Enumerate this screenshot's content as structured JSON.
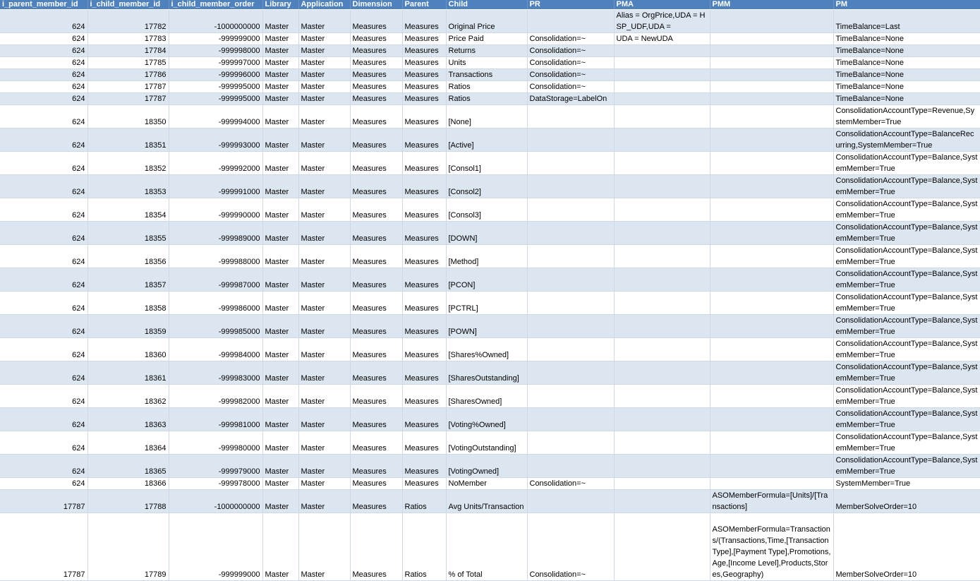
{
  "columns": [
    "i_parent_member_id",
    "i_child_member_id",
    "i_child_member_order",
    "Library",
    "Application",
    "Dimension",
    "Parent",
    "Child",
    "PR",
    "PMA",
    "PMM",
    "PM"
  ],
  "rows": [
    [
      "624",
      "17782",
      "-1000000000",
      "Master",
      "Master",
      "Measures",
      "Measures",
      "Original Price",
      "",
      "Alias = OrgPrice,UDA = HSP_UDF,UDA =",
      "",
      "TimeBalance=Last"
    ],
    [
      "624",
      "17783",
      "-999999000",
      "Master",
      "Master",
      "Measures",
      "Measures",
      "Price Paid",
      "Consolidation=~",
      "UDA = NewUDA",
      "",
      "TimeBalance=None"
    ],
    [
      "624",
      "17784",
      "-999998000",
      "Master",
      "Master",
      "Measures",
      "Measures",
      "Returns",
      "Consolidation=~",
      "",
      "",
      "TimeBalance=None"
    ],
    [
      "624",
      "17785",
      "-999997000",
      "Master",
      "Master",
      "Measures",
      "Measures",
      "Units",
      "Consolidation=~",
      "",
      "",
      "TimeBalance=None"
    ],
    [
      "624",
      "17786",
      "-999996000",
      "Master",
      "Master",
      "Measures",
      "Measures",
      "Transactions",
      "Consolidation=~",
      "",
      "",
      "TimeBalance=None"
    ],
    [
      "624",
      "17787",
      "-999995000",
      "Master",
      "Master",
      "Measures",
      "Measures",
      "Ratios",
      "Consolidation=~",
      "",
      "",
      "TimeBalance=None"
    ],
    [
      "624",
      "17787",
      "-999995000",
      "Master",
      "Master",
      "Measures",
      "Measures",
      "Ratios",
      "DataStorage=LabelOn",
      "",
      "",
      "TimeBalance=None"
    ],
    [
      "624",
      "18350",
      "-999994000",
      "Master",
      "Master",
      "Measures",
      "Measures",
      "[None]",
      "",
      "",
      "",
      "ConsolidationAccountType=Revenue,SystemMember=True"
    ],
    [
      "624",
      "18351",
      "-999993000",
      "Master",
      "Master",
      "Measures",
      "Measures",
      "[Active]",
      "",
      "",
      "",
      "ConsolidationAccountType=BalanceRecurring,SystemMember=True"
    ],
    [
      "624",
      "18352",
      "-999992000",
      "Master",
      "Master",
      "Measures",
      "Measures",
      "[Consol1]",
      "",
      "",
      "",
      "ConsolidationAccountType=Balance,SystemMember=True"
    ],
    [
      "624",
      "18353",
      "-999991000",
      "Master",
      "Master",
      "Measures",
      "Measures",
      "[Consol2]",
      "",
      "",
      "",
      "ConsolidationAccountType=Balance,SystemMember=True"
    ],
    [
      "624",
      "18354",
      "-999990000",
      "Master",
      "Master",
      "Measures",
      "Measures",
      "[Consol3]",
      "",
      "",
      "",
      "ConsolidationAccountType=Balance,SystemMember=True"
    ],
    [
      "624",
      "18355",
      "-999989000",
      "Master",
      "Master",
      "Measures",
      "Measures",
      "[DOWN]",
      "",
      "",
      "",
      "ConsolidationAccountType=Balance,SystemMember=True"
    ],
    [
      "624",
      "18356",
      "-999988000",
      "Master",
      "Master",
      "Measures",
      "Measures",
      "[Method]",
      "",
      "",
      "",
      "ConsolidationAccountType=Balance,SystemMember=True"
    ],
    [
      "624",
      "18357",
      "-999987000",
      "Master",
      "Master",
      "Measures",
      "Measures",
      "[PCON]",
      "",
      "",
      "",
      "ConsolidationAccountType=Balance,SystemMember=True"
    ],
    [
      "624",
      "18358",
      "-999986000",
      "Master",
      "Master",
      "Measures",
      "Measures",
      "[PCTRL]",
      "",
      "",
      "",
      "ConsolidationAccountType=Balance,SystemMember=True"
    ],
    [
      "624",
      "18359",
      "-999985000",
      "Master",
      "Master",
      "Measures",
      "Measures",
      "[POWN]",
      "",
      "",
      "",
      "ConsolidationAccountType=Balance,SystemMember=True"
    ],
    [
      "624",
      "18360",
      "-999984000",
      "Master",
      "Master",
      "Measures",
      "Measures",
      "[Shares%Owned]",
      "",
      "",
      "",
      "ConsolidationAccountType=Balance,SystemMember=True"
    ],
    [
      "624",
      "18361",
      "-999983000",
      "Master",
      "Master",
      "Measures",
      "Measures",
      "[SharesOutstanding]",
      "",
      "",
      "",
      "ConsolidationAccountType=Balance,SystemMember=True"
    ],
    [
      "624",
      "18362",
      "-999982000",
      "Master",
      "Master",
      "Measures",
      "Measures",
      "[SharesOwned]",
      "",
      "",
      "",
      "ConsolidationAccountType=Balance,SystemMember=True"
    ],
    [
      "624",
      "18363",
      "-999981000",
      "Master",
      "Master",
      "Measures",
      "Measures",
      "[Voting%Owned]",
      "",
      "",
      "",
      "ConsolidationAccountType=Balance,SystemMember=True"
    ],
    [
      "624",
      "18364",
      "-999980000",
      "Master",
      "Master",
      "Measures",
      "Measures",
      "[VotingOutstanding]",
      "",
      "",
      "",
      "ConsolidationAccountType=Balance,SystemMember=True"
    ],
    [
      "624",
      "18365",
      "-999979000",
      "Master",
      "Master",
      "Measures",
      "Measures",
      "[VotingOwned]",
      "",
      "",
      "",
      "ConsolidationAccountType=Balance,SystemMember=True"
    ],
    [
      "624",
      "18366",
      "-999978000",
      "Master",
      "Master",
      "Measures",
      "Measures",
      "NoMember",
      "Consolidation=~",
      "",
      "",
      "SystemMember=True"
    ],
    [
      "17787",
      "17788",
      "-1000000000",
      "Master",
      "Master",
      "Measures",
      "Ratios",
      "Avg Units/Transaction",
      "",
      "",
      "ASOMemberFormula=[Units]/[Transactions]",
      "MemberSolveOrder=10"
    ],
    [
      "17787",
      "17789",
      "-999999000",
      "Master",
      "Master",
      "Measures",
      "Ratios",
      "% of Total",
      "Consolidation=~",
      "",
      "ASOMemberFormula=Transactions/(Transactions,Time,[Transaction Type],[Payment Type],Promotions,Age,[Income Level],Products,Stores,Geography)",
      "MemberSolveOrder=10"
    ]
  ]
}
